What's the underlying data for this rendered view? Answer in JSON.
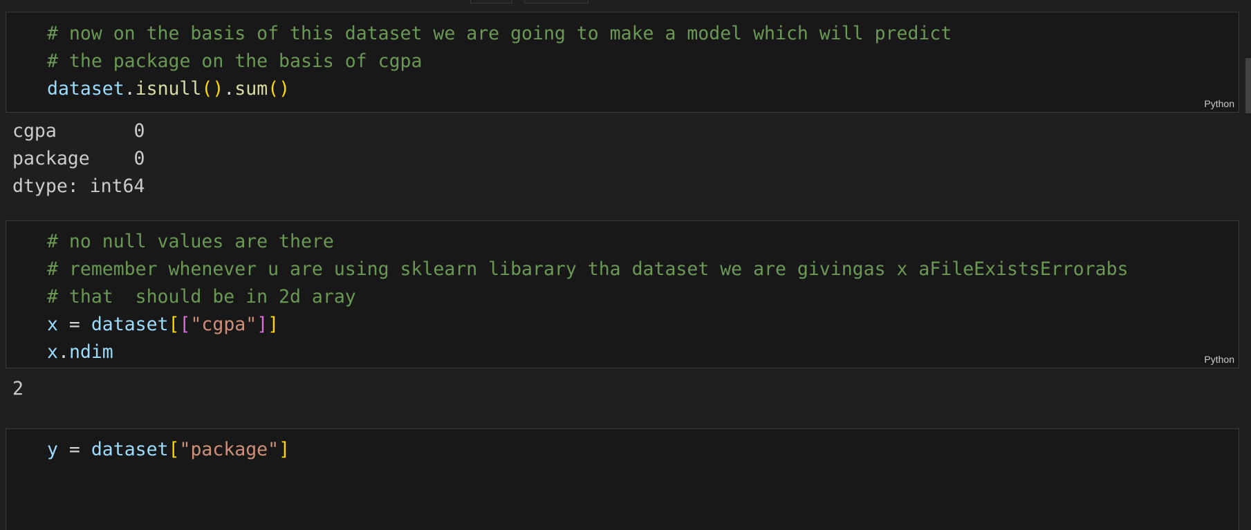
{
  "cells": [
    {
      "language": "Python",
      "lines": [
        [
          {
            "t": "# now on the basis of this dataset we are going to make a model which will predict",
            "c": "com"
          }
        ],
        [
          {
            "t": "# the package on the basis of cgpa",
            "c": "com"
          }
        ],
        [
          {
            "t": "dataset",
            "c": "var"
          },
          {
            "t": ".",
            "c": "op"
          },
          {
            "t": "isnull",
            "c": "fn"
          },
          {
            "t": "()",
            "c": "br1"
          },
          {
            "t": ".",
            "c": "op"
          },
          {
            "t": "sum",
            "c": "fn"
          },
          {
            "t": "()",
            "c": "br1"
          }
        ]
      ],
      "output": [
        "cgpa       0",
        "package    0",
        "dtype: int64"
      ]
    },
    {
      "language": "Python",
      "lines": [
        [
          {
            "t": "# no null values are there",
            "c": "com"
          }
        ],
        [
          {
            "t": "# remember whenever u are using sklearn libarary tha dataset we are givingas x aFileExistsErrorabs",
            "c": "com"
          }
        ],
        [
          {
            "t": "# that  should be in 2d aray",
            "c": "com"
          }
        ],
        [
          {
            "t": "x",
            "c": "var"
          },
          {
            "t": " = ",
            "c": "op"
          },
          {
            "t": "dataset",
            "c": "var"
          },
          {
            "t": "[",
            "c": "br1"
          },
          {
            "t": "[",
            "c": "br2"
          },
          {
            "t": "\"cgpa\"",
            "c": "str"
          },
          {
            "t": "]",
            "c": "br2"
          },
          {
            "t": "]",
            "c": "br1"
          }
        ],
        [
          {
            "t": "x",
            "c": "var"
          },
          {
            "t": ".",
            "c": "op"
          },
          {
            "t": "ndim",
            "c": "var"
          }
        ]
      ],
      "output": [
        "2"
      ]
    },
    {
      "language": "Python",
      "lines": [
        [
          {
            "t": "y",
            "c": "var"
          },
          {
            "t": " = ",
            "c": "op"
          },
          {
            "t": "dataset",
            "c": "var"
          },
          {
            "t": "[",
            "c": "br1"
          },
          {
            "t": "\"package\"",
            "c": "str"
          },
          {
            "t": "]",
            "c": "br1"
          }
        ]
      ],
      "output": []
    }
  ],
  "theme": {
    "background": "#1f1f1f",
    "cell_background": "#181818",
    "comment": "#6a9955",
    "variable": "#9cdcfe",
    "function": "#dcdcaa",
    "string": "#ce9178",
    "bracket_1": "#ffd700",
    "bracket_2": "#da70d6"
  }
}
